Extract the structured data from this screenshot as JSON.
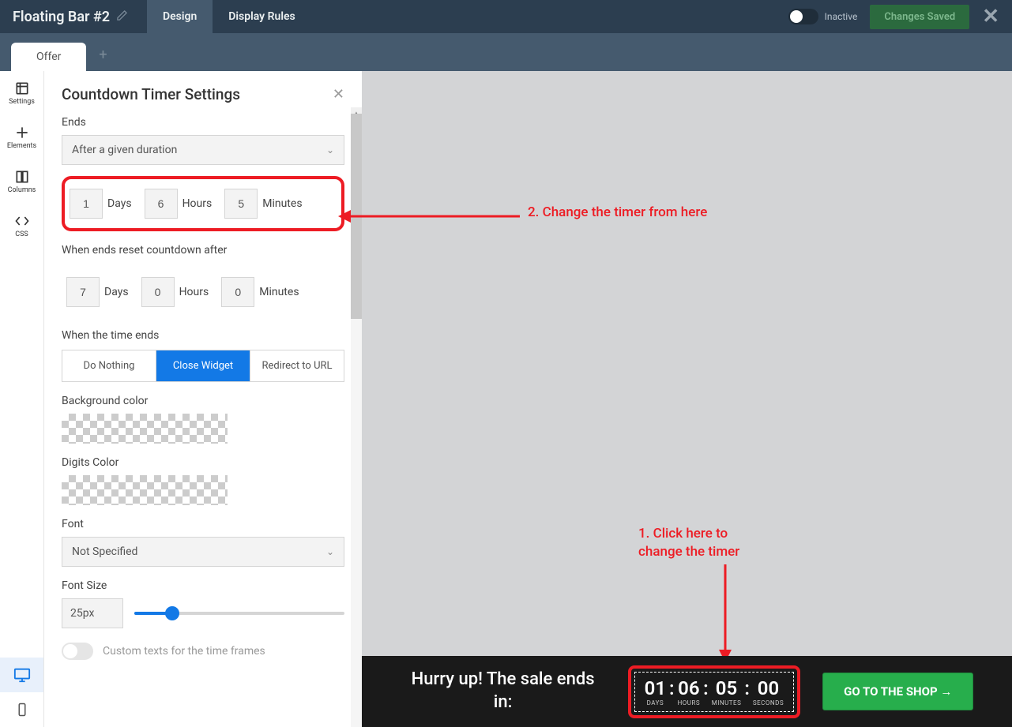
{
  "header": {
    "title": "Floating Bar #2",
    "tabs": {
      "design": "Design",
      "display_rules": "Display Rules"
    },
    "status_label": "Inactive",
    "changes_saved": "Changes Saved"
  },
  "subheader": {
    "tab_offer": "Offer"
  },
  "rail": {
    "settings": "Settings",
    "elements": "Elements",
    "columns": "Columns",
    "css": "CSS"
  },
  "panel": {
    "title": "Countdown Timer Settings",
    "ends_label": "Ends",
    "ends_select": "After a given duration",
    "duration1": {
      "days_val": "1",
      "days": "Days",
      "hours_val": "6",
      "hours": "Hours",
      "minutes_val": "5",
      "minutes": "Minutes"
    },
    "reset_label": "When ends reset countdown after",
    "duration2": {
      "days_val": "7",
      "days": "Days",
      "hours_val": "0",
      "hours": "Hours",
      "minutes_val": "0",
      "minutes": "Minutes"
    },
    "time_ends_label": "When the time ends",
    "opt_nothing": "Do Nothing",
    "opt_close": "Close Widget",
    "opt_redirect": "Redirect to URL",
    "bg_color_label": "Background color",
    "digits_color_label": "Digits Color",
    "font_label": "Font",
    "font_select": "Not Specified",
    "font_size_label": "Font Size",
    "font_size_val": "25px",
    "custom_texts_label": "Custom texts for the time frames"
  },
  "preview": {
    "message": "Hurry up! The sale ends in:",
    "timer": {
      "d_val": "01",
      "d_lab": "DAYS",
      "h_val": "06",
      "h_lab": "HOURS",
      "m_val": "05",
      "m_lab": "MINUTES",
      "s_val": "00",
      "s_lab": "SECONDS"
    },
    "button": "GO TO THE SHOP →"
  },
  "annotations": {
    "a1": "1. Click here to change the timer",
    "a2": "2. Change the timer from here"
  }
}
